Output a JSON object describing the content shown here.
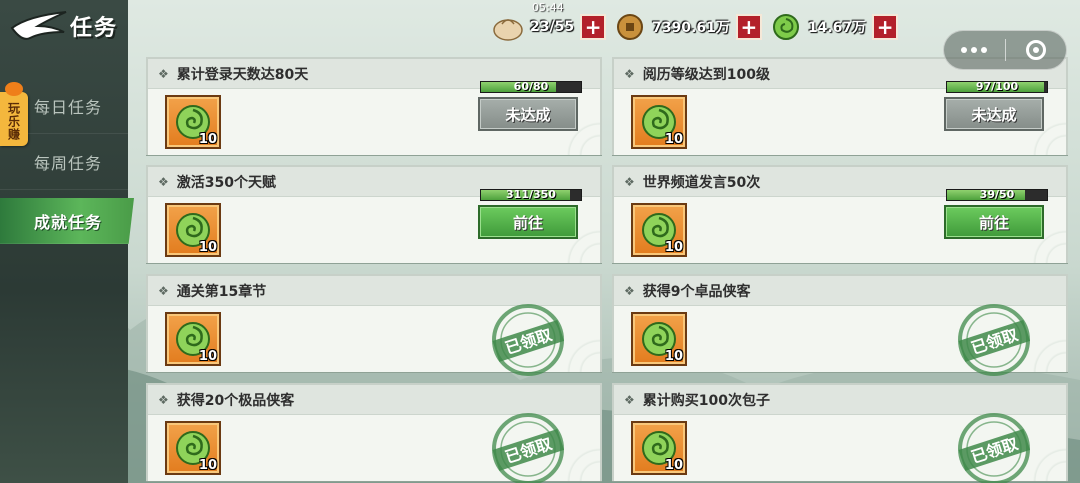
{
  "header": {
    "title": "任务",
    "time": "05:44"
  },
  "resources": [
    {
      "icon": "bun-icon",
      "value": "23/55"
    },
    {
      "icon": "copper-coin-icon",
      "value": "7390.61万"
    },
    {
      "icon": "jade-icon",
      "value": "14.67万"
    }
  ],
  "badge": {
    "label": "玩乐赚"
  },
  "sidebar": {
    "items": [
      {
        "label": "每日任务",
        "active": false
      },
      {
        "label": "每周任务",
        "active": false
      },
      {
        "label": "成就任务",
        "active": true
      }
    ]
  },
  "reward_icon": "jade-icon",
  "tasks": [
    {
      "title": "累计登录天数达80天",
      "reward_qty": "10",
      "progress_text": "60/80",
      "progress": 0.75,
      "button": "未达成",
      "state": "incomplete"
    },
    {
      "title": "阅历等级达到100级",
      "reward_qty": "10",
      "progress_text": "97/100",
      "progress": 0.97,
      "button": "未达成",
      "state": "incomplete"
    },
    {
      "title": "激活350个天赋",
      "reward_qty": "10",
      "progress_text": "311/350",
      "progress": 0.889,
      "button": "前往",
      "state": "goto"
    },
    {
      "title": "世界频道发言50次",
      "reward_qty": "10",
      "progress_text": "39/50",
      "progress": 0.78,
      "button": "前往",
      "state": "goto"
    },
    {
      "title": "通关第15章节",
      "reward_qty": "10",
      "stamp": "已领取",
      "state": "claimed"
    },
    {
      "title": "获得9个卓品侠客",
      "reward_qty": "10",
      "stamp": "已领取",
      "state": "claimed"
    },
    {
      "title": "获得20个极品侠客",
      "reward_qty": "10",
      "stamp": "已领取",
      "state": "claimed"
    },
    {
      "title": "累计购买100次包子",
      "reward_qty": "10",
      "stamp": "已领取",
      "state": "claimed"
    }
  ],
  "colors": {
    "accent_green": "#4da13c",
    "plus_red": "#b3202a",
    "reward_orange": "#e27c1e"
  }
}
